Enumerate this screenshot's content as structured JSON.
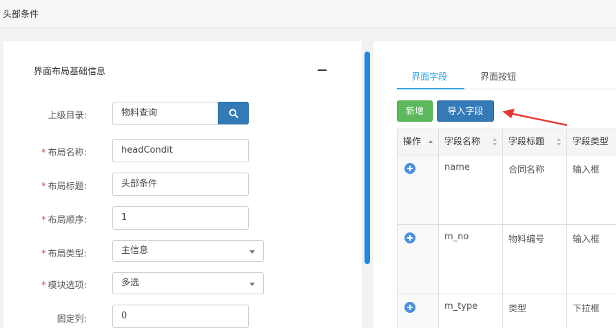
{
  "header": {
    "title": "头部条件"
  },
  "panel": {
    "title": "界面布局基础信息"
  },
  "form": {
    "parent_dir": {
      "label": "上级目录:",
      "value": "物料查询"
    },
    "layout_name": {
      "label": "布局名称:",
      "value": "headCondit",
      "required": true
    },
    "layout_title": {
      "label": "布局标题:",
      "value": "头部条件",
      "required": true
    },
    "layout_order": {
      "label": "布局顺序:",
      "value": "1",
      "required": true
    },
    "layout_type": {
      "label": "布局类型:",
      "value": "主信息",
      "required": true
    },
    "module_option": {
      "label": "模块选项:",
      "value": "多选",
      "required": true
    },
    "fixed_cols": {
      "label": "固定列:",
      "value": "0"
    }
  },
  "tabs": [
    {
      "label": "界面字段",
      "active": true
    },
    {
      "label": "界面按钮",
      "active": false
    }
  ],
  "toolbar": {
    "add_label": "新增",
    "import_label": "导入字段"
  },
  "table": {
    "columns": [
      "操作",
      "字段名称",
      "字段标题",
      "字段类型"
    ],
    "rows": [
      {
        "name": "name",
        "title": "合同名称",
        "type": "输入框"
      },
      {
        "name": "m_no",
        "title": "物料编号",
        "type": "输入框"
      },
      {
        "name": "m_type",
        "title": "类型",
        "type": "下拉框"
      }
    ]
  },
  "colors": {
    "primary": "#337ab7",
    "success": "#5cb85c",
    "tab_active": "#39a3e6",
    "required": "#e53935",
    "arrow": "#e53935"
  }
}
